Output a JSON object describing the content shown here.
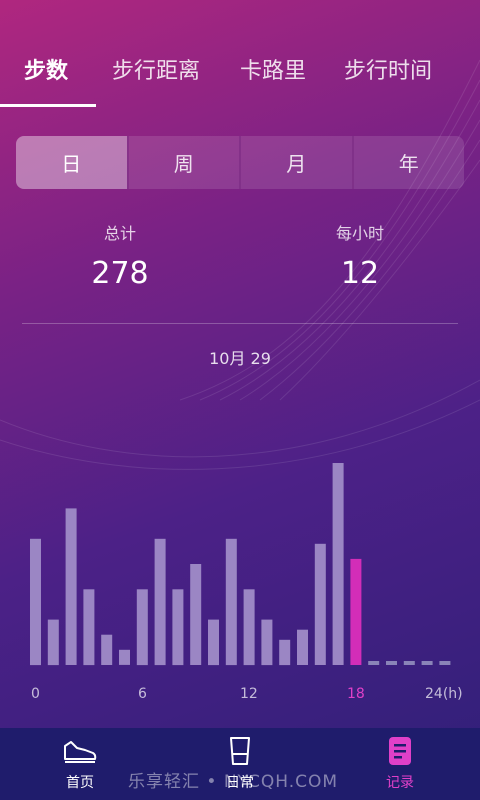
{
  "tabs": [
    "步数",
    "步行距离",
    "卡路里",
    "步行时间"
  ],
  "period": [
    "日",
    "周",
    "月",
    "年"
  ],
  "stats": {
    "total_label": "总计",
    "total_value": "278",
    "hourly_label": "每小时",
    "hourly_value": "12"
  },
  "date": "10月 29",
  "chart_data": {
    "type": "bar",
    "categories": [
      "0",
      "1",
      "2",
      "3",
      "4",
      "5",
      "6",
      "7",
      "8",
      "9",
      "10",
      "11",
      "12",
      "13",
      "14",
      "15",
      "16",
      "17",
      "18",
      "19",
      "20",
      "21",
      "22",
      "23"
    ],
    "values": [
      25,
      9,
      31,
      15,
      6,
      3,
      15,
      25,
      15,
      20,
      9,
      25,
      15,
      9,
      5,
      7,
      24,
      40,
      21,
      0,
      0,
      0,
      0,
      0
    ],
    "highlight_index": 18,
    "xticks": [
      "0",
      "6",
      "12",
      "18",
      "24(h)"
    ],
    "ylim": [
      0,
      40
    ],
    "colors": {
      "bar": "#9b86c4",
      "highlight": "#d32db8",
      "empty": "#8a84b8"
    }
  },
  "nav": {
    "home": "首页",
    "daily": "日常",
    "records": "记录"
  },
  "watermark": "乐享轻汇 • NYCQH.COM"
}
